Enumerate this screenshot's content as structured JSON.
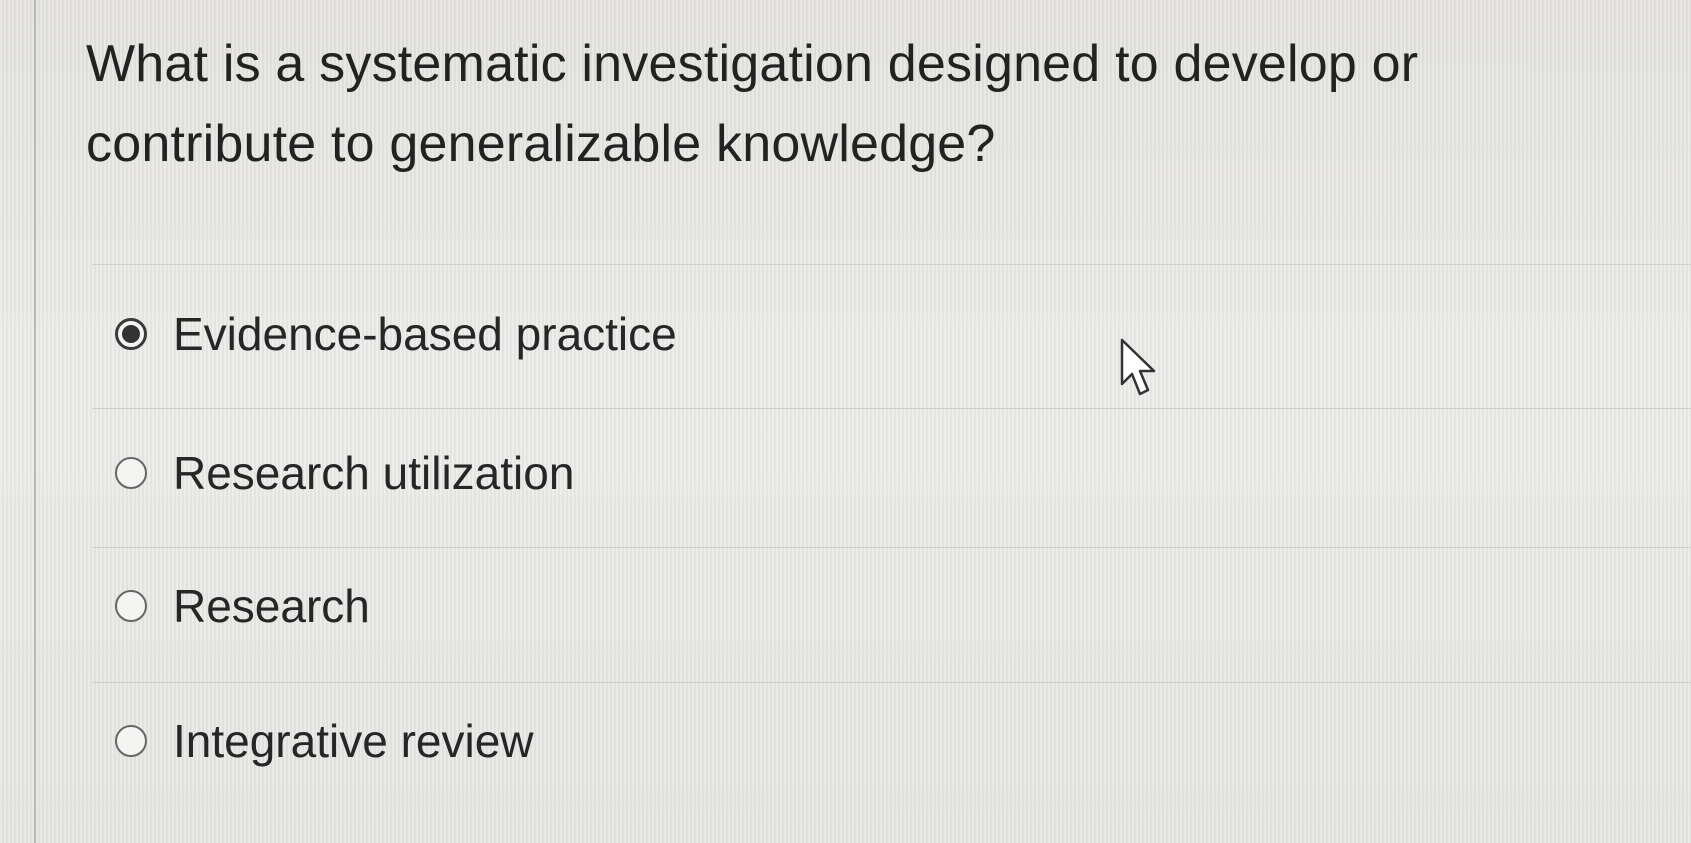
{
  "question": {
    "text": "What is a systematic investigation designed to develop or contribute to generalizable knowledge?"
  },
  "options": [
    {
      "label": "Evidence-based practice",
      "selected": true
    },
    {
      "label": "Research utilization",
      "selected": false
    },
    {
      "label": "Research",
      "selected": false
    },
    {
      "label": "Integrative review",
      "selected": false
    }
  ],
  "colors": {
    "background": "#e6e6e2",
    "text": "#222222",
    "radio_border": "#666666",
    "divider": "#cfcfcb"
  },
  "icons": {
    "cursor": "mouse-pointer-icon",
    "radio_selected": "radio-selected-icon",
    "radio_unselected": "radio-unselected-icon"
  }
}
